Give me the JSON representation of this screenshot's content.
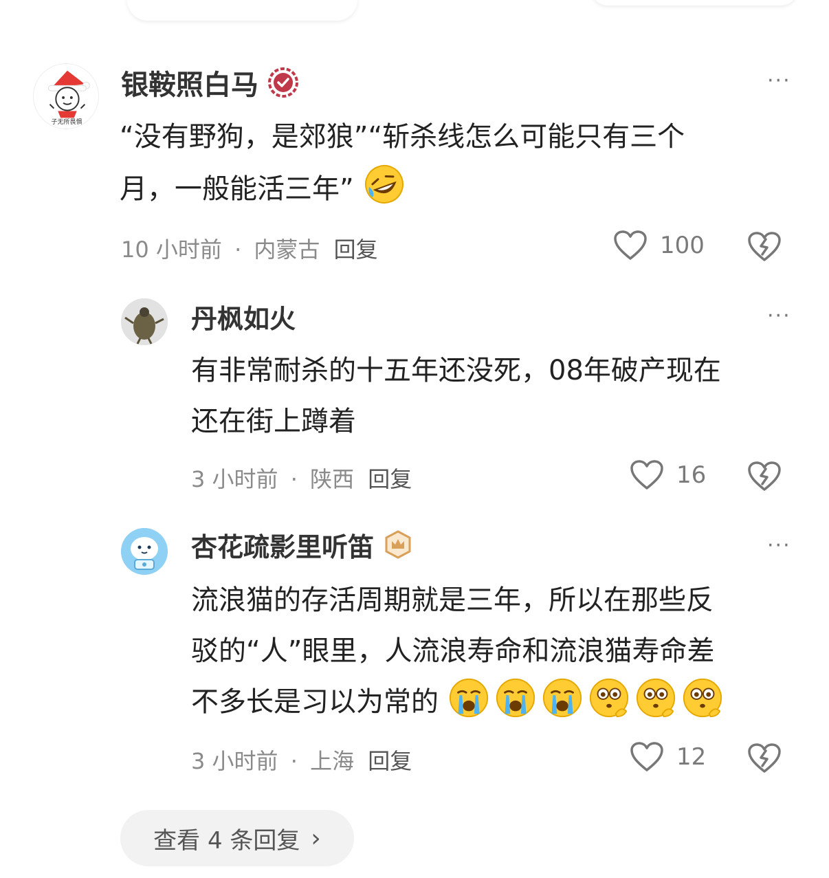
{
  "comments": [
    {
      "user": "银鞍照白马",
      "text_1": "“没有野狗，是郊狼”“斩杀线怎么可能只有三个",
      "text_2": "月，一般能活三年”",
      "time": "10 小时前",
      "location": "内蒙古",
      "reply": "回复",
      "likes": "100",
      "badge_icon": "verified-badge-icon",
      "avatar_caption": "子无所畏惧"
    },
    {
      "user": "丹枫如火",
      "text_1": "有非常耐杀的十五年还没死，08年破产现在",
      "text_2": "还在街上蹲着",
      "time": "3 小时前",
      "location": "陕西",
      "reply": "回复",
      "likes": "16"
    },
    {
      "user": "杏花疏影里听笛",
      "text_1": "流浪猫的存活周期就是三年，所以在那些反",
      "text_2": "驳的“人”眼里，人流浪寿命和流浪猫寿命差",
      "text_3": "不多长是习以为常的",
      "time": "3 小时前",
      "location": "上海",
      "reply": "回复",
      "likes": "12",
      "badge_icon": "crown-badge-icon"
    }
  ],
  "separator": "·",
  "more_label": "···",
  "view_more": {
    "label": "查看 4 条回复",
    "chevron": "›"
  },
  "colors": {
    "verified": "#c0394b",
    "crown": "#d9a05b",
    "text": "#222222",
    "meta": "#8a8a8a"
  }
}
